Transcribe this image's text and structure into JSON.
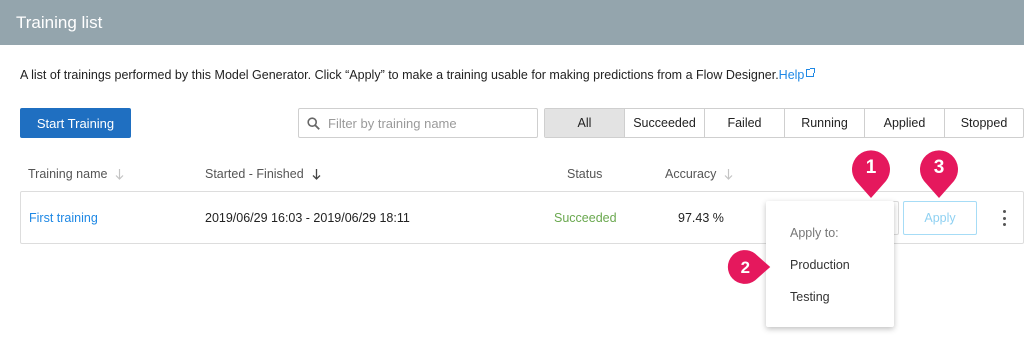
{
  "header": {
    "title": "Training list"
  },
  "description": {
    "text": "A list of trainings performed by this Model Generator. Click “Apply” to make a training usable for making predictions from a Flow Designer.",
    "help_label": "Help"
  },
  "toolbar": {
    "start_label": "Start Training",
    "search_placeholder": "Filter by training name",
    "filters": [
      "All",
      "Succeeded",
      "Failed",
      "Running",
      "Applied",
      "Stopped"
    ],
    "active_filter": "All"
  },
  "table": {
    "columns": [
      "Training name",
      "Started - Finished",
      "Status",
      "Accuracy"
    ],
    "rows": [
      {
        "name": "First training",
        "started_finished": "2019/06/29 16:03 - 2019/06/29 18:11",
        "status": "Succeeded",
        "accuracy": "97.43 %",
        "apply_label": "Apply"
      }
    ]
  },
  "apply_menu": {
    "title": "Apply to:",
    "options": [
      "Production",
      "Testing"
    ]
  },
  "markers": [
    "1",
    "2",
    "3"
  ],
  "colors": {
    "header_bg": "#94a5ad",
    "primary": "#1f6fc1",
    "link": "#1e88e5",
    "success": "#6aa84f",
    "marker": "#e5185d"
  }
}
